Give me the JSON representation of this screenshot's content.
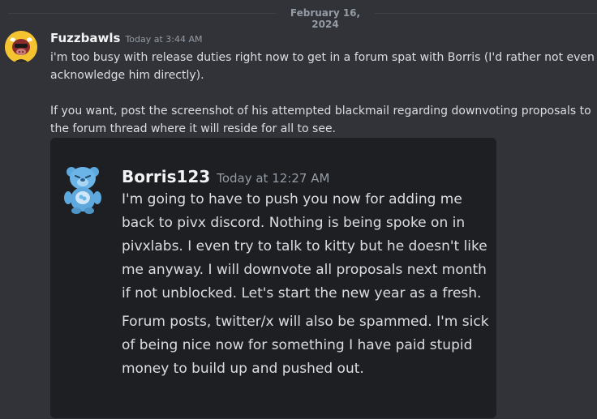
{
  "divider": {
    "date": "February 16, 2024"
  },
  "message": {
    "author": "Fuzzbawls",
    "timestamp": "Today at 3:44 AM",
    "paragraphs": [
      "i'm too busy with release duties right now to get in a forum spat with Borris (I'd rather not even acknowledge him directly).",
      "If you want, post the screenshot of his attempted blackmail regarding downvoting proposals to the forum thread where it will reside for all to see."
    ],
    "avatar_icon": "bull-avatar-icon"
  },
  "screenshot": {
    "author": "Borris123",
    "timestamp": "Today at 12:27 AM",
    "paragraphs": [
      "I'm going to have to push you now for adding me back to pivx discord. Nothing is being spoke on in pivxlabs. I even try to talk to kitty but he doesn't like me anyway. I will downvote all proposals next month if not unblocked. Let's start the new year as a fresh.",
      "Forum posts, twitter/x will also be spammed. I'm sick of being nice now for something I have paid stupid money to build up and pushed out."
    ],
    "avatar_icon": "blue-bear-avatar-icon"
  },
  "colors": {
    "background": "#313338",
    "embed_background": "#1e1f22",
    "text": "#dbdee1",
    "muted": "#949ba4",
    "username": "#f2f3f5"
  }
}
